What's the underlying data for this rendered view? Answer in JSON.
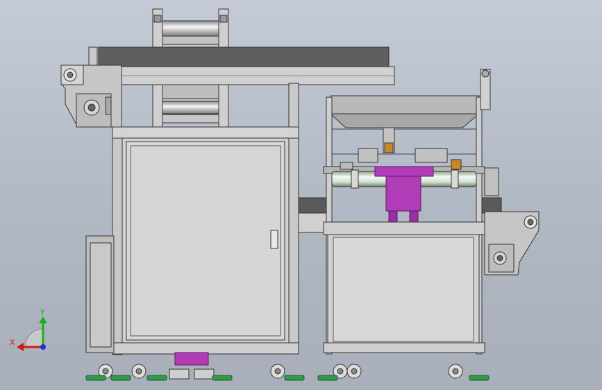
{
  "triad": {
    "x_label": "X",
    "y_label": "Y",
    "x_color": "#d01818",
    "y_color": "#18b018",
    "z_color": "#2030d0"
  },
  "colors": {
    "frame_metal": "#c9c9c9",
    "panel": "#d2d2d2",
    "belt": "#5f5f5f",
    "roller": "#e6efe6",
    "magenta_part": "#b03cb8",
    "foot_green": "#2e9a4a",
    "amber_part": "#c8882a"
  }
}
